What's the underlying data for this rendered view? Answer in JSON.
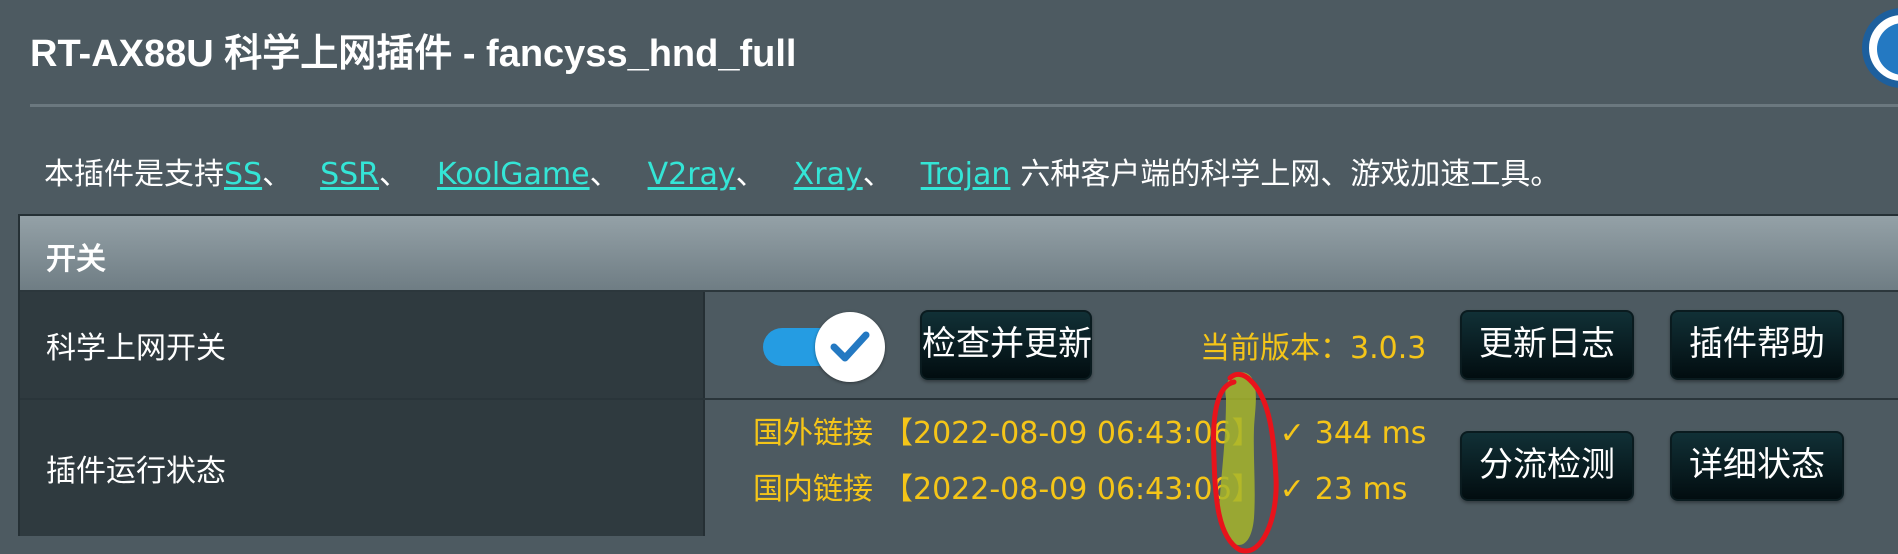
{
  "app_title": "RT-AX88U 科学上网插件 - fancyss_hnd_full",
  "header": {
    "back_button_icon": "back-arrow-icon"
  },
  "description": {
    "prefix": "本插件是支持",
    "links": [
      "SS",
      "SSR",
      "KoolGame",
      "V2ray",
      "Xray",
      "Trojan"
    ],
    "separator": "、",
    "suffix": "六种客户端的科学上网、游戏加速工具。"
  },
  "panel": {
    "header": "开关",
    "switch_row": {
      "label": "科学上网开关",
      "toggle_on": true,
      "toggle_icon": "check-icon",
      "check_update_button": "检查并更新",
      "version_label": "当前版本：3.0.3",
      "changelog_button": "更新日志",
      "help_button": "插件帮助"
    },
    "status_row": {
      "label": "插件运行状态",
      "foreign": {
        "name": "国外链接",
        "timestamp": "【2022-08-09 06:43:06】",
        "check": "✓",
        "latency": "344 ms"
      },
      "domestic": {
        "name": "国内链接",
        "timestamp": "【2022-08-09 06:43:06】",
        "check": "✓",
        "latency": "23 ms"
      },
      "route_check_button": "分流检测",
      "detail_status_button": "详细状态"
    }
  },
  "colors": {
    "background": "#4d5a61",
    "link": "#34e5d6",
    "status_text": "#f5c518",
    "toggle_on": "#259ce2",
    "annotation_red": "#e8131b",
    "annotation_highlight": "#a7b52c"
  }
}
